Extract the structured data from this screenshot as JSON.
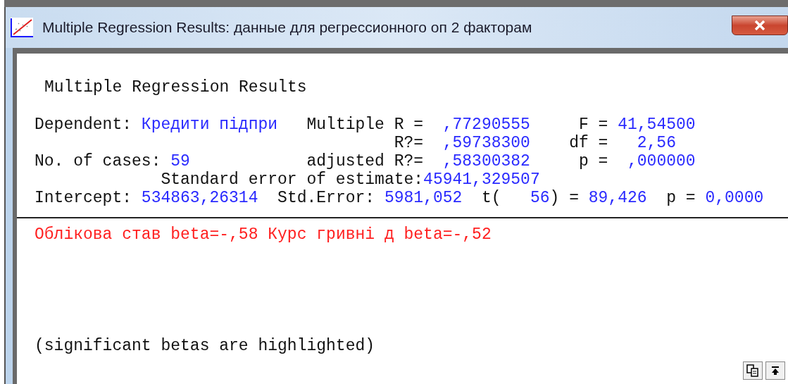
{
  "window": {
    "title": "Multiple Regression Results: данные для регрессионного оп 2 факторам"
  },
  "heading": "Multiple Regression Results",
  "summary_lines": [
    [
      {
        "text": "Dependent: ",
        "kind": "label"
      },
      {
        "text": "Кредити підпри",
        "kind": "value"
      },
      {
        "text": "   Multiple R =  ",
        "kind": "label"
      },
      {
        "text": ",77290555",
        "kind": "value"
      },
      {
        "text": "     F = ",
        "kind": "label"
      },
      {
        "text": "41,54500",
        "kind": "value"
      }
    ],
    [
      {
        "text": "                                     R?=  ",
        "kind": "label"
      },
      {
        "text": ",59738300",
        "kind": "value"
      },
      {
        "text": "    df =   ",
        "kind": "label"
      },
      {
        "text": "2,56",
        "kind": "value"
      }
    ],
    [
      {
        "text": "No. of cases: ",
        "kind": "label"
      },
      {
        "text": "59",
        "kind": "value"
      },
      {
        "text": "            adjusted R?=  ",
        "kind": "label"
      },
      {
        "text": ",58300382",
        "kind": "value"
      },
      {
        "text": "     p =  ",
        "kind": "label"
      },
      {
        "text": ",000000",
        "kind": "value"
      }
    ],
    [
      {
        "text": "             Standard error of estimate:",
        "kind": "label"
      },
      {
        "text": "45941,329507",
        "kind": "value"
      }
    ],
    [
      {
        "text": "Intercept: ",
        "kind": "label"
      },
      {
        "text": "534863,26314",
        "kind": "value"
      },
      {
        "text": "  Std.Error: ",
        "kind": "label"
      },
      {
        "text": "5981,052",
        "kind": "value"
      },
      {
        "text": "  t(   ",
        "kind": "label"
      },
      {
        "text": "56",
        "kind": "value"
      },
      {
        "text": ") = ",
        "kind": "label"
      },
      {
        "text": "89,426",
        "kind": "value"
      },
      {
        "text": "  p = ",
        "kind": "label"
      },
      {
        "text": "0,0000",
        "kind": "value"
      }
    ]
  ],
  "betas": [
    {
      "text": "Облікова став beta=-,58",
      "highlighted": true
    },
    {
      "text": "Курс гривні д beta=-,52",
      "highlighted": true
    }
  ],
  "note": "(significant betas are highlighted)"
}
